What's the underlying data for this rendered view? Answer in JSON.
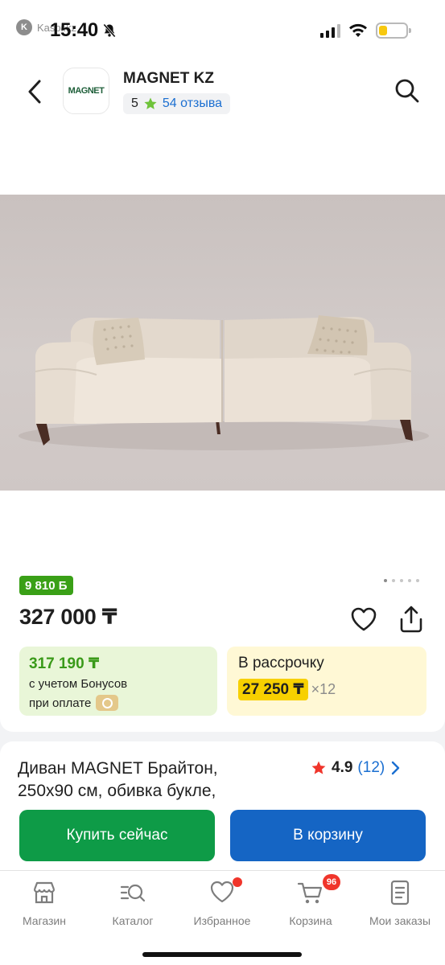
{
  "status_bar": {
    "carrier_label": "Kaspi.kz",
    "time": "15:40",
    "battery_level": 0.3,
    "battery_color": "#f7c80f"
  },
  "header": {
    "shop_name": "MAGNET KZ",
    "logo_text": "MAGNET",
    "rating": "5",
    "reviews_link": "54 отзыва",
    "back_icon": "chevron-left-icon",
    "search_icon": "search-icon"
  },
  "gallery": {
    "image_subject": "sofa",
    "total_images": 5,
    "active_index": 0
  },
  "pricing": {
    "bonus_badge": "9 810 Б",
    "price": "327 000 ₸",
    "bonus_offer": {
      "value": "317 190 ₸",
      "line1": "с учетом Бонусов",
      "line2": "при оплате"
    },
    "installment": {
      "title": "В рассрочку",
      "monthly": "27 250 ₸",
      "multiplier": "×12"
    }
  },
  "product": {
    "title": "Диван MAGNET Брайтон, 250x90 см, обивка букле,",
    "rating_value": "4.9",
    "rating_count": "(12)"
  },
  "actions": {
    "buy_now": "Купить сейчас",
    "add_to_cart": "В корзину"
  },
  "bottom_nav": {
    "items": [
      {
        "label": "Магазин",
        "icon": "store-icon"
      },
      {
        "label": "Каталог",
        "icon": "catalog-search-icon"
      },
      {
        "label": "Избранное",
        "icon": "heart-icon"
      },
      {
        "label": "Корзина",
        "icon": "cart-icon",
        "badge": "96"
      },
      {
        "label": "Мои заказы",
        "icon": "orders-icon"
      }
    ]
  },
  "colors": {
    "bonus_green": "#3aa017",
    "credit_yellow": "#f7d000",
    "buy_button": "#0e9b47",
    "cart_button": "#1565c4",
    "link_blue": "#1b6fd1",
    "badge_red": "#f0352b"
  }
}
